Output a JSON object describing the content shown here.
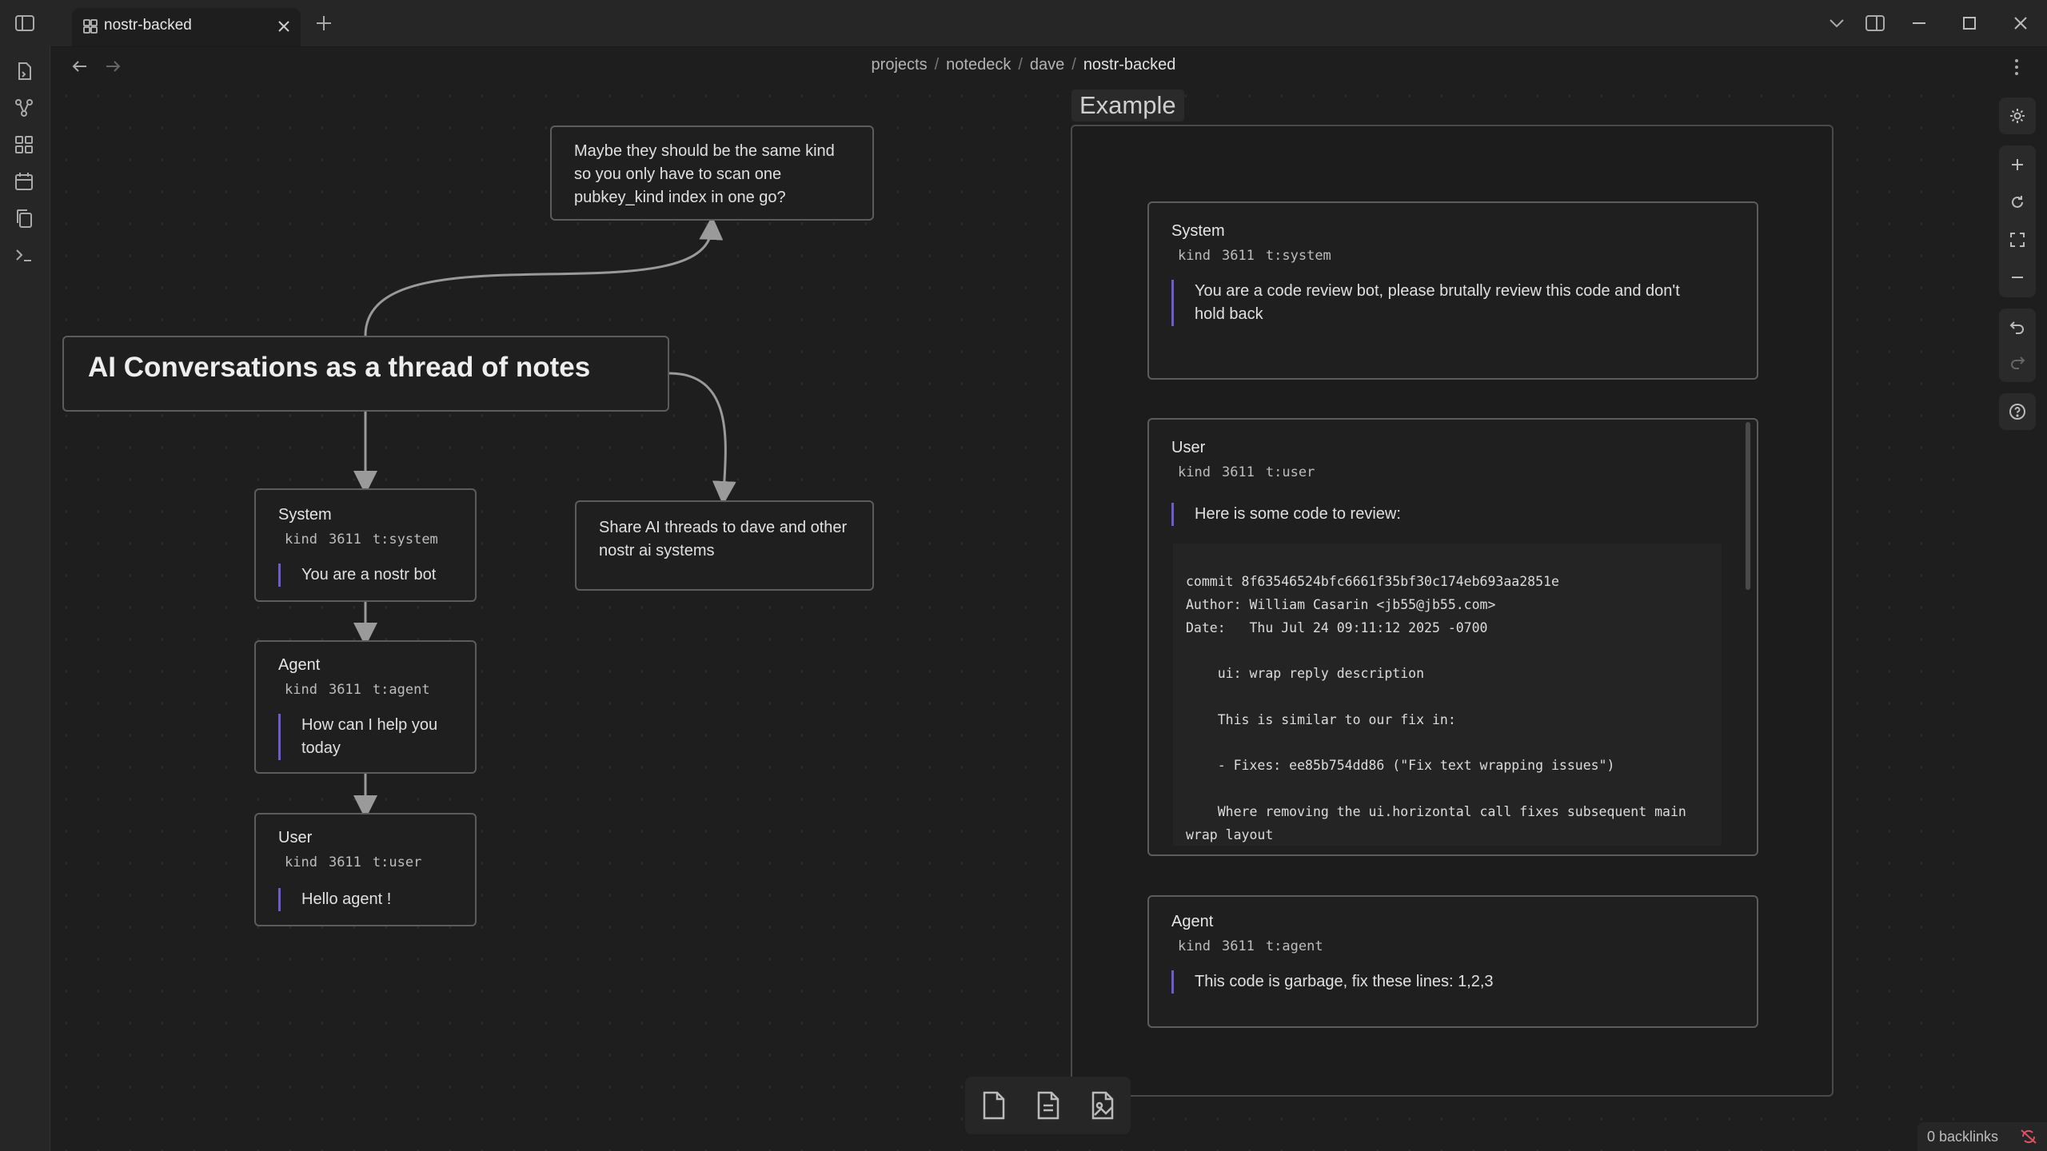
{
  "tab": {
    "title": "nostr-backed"
  },
  "breadcrumb": [
    "projects",
    "notedeck",
    "dave",
    "nostr-backed"
  ],
  "canvas": {
    "main_title": "AI Conversations as a thread of notes",
    "note_top": "Maybe they should be the same kind so you only have to scan one pubkey_kind index in one go?",
    "note_share": "Share AI threads to dave and other nostr ai systems",
    "left_thread": [
      {
        "role": "System",
        "kind": "kind",
        "kind_num": "3611",
        "tag": "t:system",
        "text": "You are a nostr bot"
      },
      {
        "role": "Agent",
        "kind": "kind",
        "kind_num": "3611",
        "tag": "t:agent",
        "text": "How can I help you today"
      },
      {
        "role": "User",
        "kind": "kind",
        "kind_num": "3611",
        "tag": "t:user",
        "text": "Hello agent !"
      }
    ],
    "example": {
      "label": "Example",
      "system": {
        "role": "System",
        "kind": "kind",
        "kind_num": "3611",
        "tag": "t:system",
        "text": "You are a code review bot, please brutally review this code and don't hold back"
      },
      "user": {
        "role": "User",
        "kind": "kind",
        "kind_num": "3611",
        "tag": "t:user",
        "text": "Here is some code to review:",
        "code": "commit 8f63546524bfc6661f35bf30c174eb693aa2851e\nAuthor: William Casarin <jb55@jb55.com>\nDate:   Thu Jul 24 09:11:12 2025 -0700\n\n    ui: wrap reply description\n\n    This is similar to our fix in:\n\n    - Fixes: ee85b754dd86 (\"Fix text wrapping issues\")\n\n    Where removing the ui.horizontal call fixes subsequent main\nwrap layout"
      },
      "agent": {
        "role": "Agent",
        "kind": "kind",
        "kind_num": "3611",
        "tag": "t:agent",
        "text": "This code is garbage, fix these lines: 1,2,3"
      }
    }
  },
  "status": {
    "backlinks": "0 backlinks"
  },
  "icons": {
    "titlebar": [
      "sidebar-toggle-icon",
      "canvas-icon",
      "close-icon",
      "plus-icon",
      "chevron-down-icon",
      "right-sidebar-icon",
      "minimize-icon",
      "maximize-icon",
      "window-close-icon"
    ],
    "ribbon": [
      "file-switcher-icon",
      "graph-icon",
      "canvas-icon",
      "calendar-icon",
      "copy-icon",
      "terminal-icon"
    ],
    "canvas_controls": [
      "settings-icon",
      "zoom-in-icon",
      "reset-zoom-icon",
      "fit-icon",
      "zoom-out-icon",
      "undo-icon",
      "redo-icon",
      "help-icon"
    ],
    "bottom_toolbar": [
      "new-card-icon",
      "add-note-icon",
      "add-media-icon"
    ]
  },
  "colors": {
    "accent": "#6d5dd3",
    "background": "#1e1e1e",
    "border": "#5c5c5c"
  }
}
